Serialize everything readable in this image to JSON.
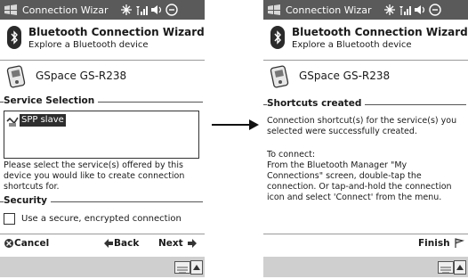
{
  "left": {
    "title": "Connection Wizar",
    "header": {
      "title": "Bluetooth Connection Wizard",
      "subtitle": "Explore a Bluetooth device"
    },
    "device_name": "GSpace GS-R238",
    "service_section": "Service Selection",
    "services": [
      "SPP slave"
    ],
    "instruction": "Please select the service(s) offered by this device you would like to create connection shortcuts for.",
    "security_section": "Security",
    "checkbox_label": "Use a secure, encrypted connection",
    "checkbox_checked": false,
    "commands": {
      "cancel": "Cancel",
      "back": "Back",
      "next": "Next"
    }
  },
  "right": {
    "title": "Connection Wizar",
    "header": {
      "title": "Bluetooth Connection Wizard",
      "subtitle": "Explore a Bluetooth device"
    },
    "device_name": "GSpace GS-R238",
    "shortcuts_section": "Shortcuts created",
    "result_text": "Connection shortcut(s) for the service(s) you selected were successfully created.",
    "to_connect_heading": "To connect:",
    "to_connect_text": "From the Bluetooth Manager \"My Connections\" screen, double-tap the connection. Or tap-and-hold the connection icon and select 'Connect' from the menu.",
    "commands": {
      "finish": "Finish"
    }
  },
  "colors": {
    "titlebar": "#5a5a5a",
    "selection": "#2e2e2e",
    "sip_bar": "#cfcfcf"
  },
  "icons": [
    "windows-logo-icon",
    "connectivity-icon",
    "signal-icon",
    "volume-icon",
    "ok-icon",
    "bluetooth-icon",
    "device-icon",
    "keyboard-icon"
  ]
}
